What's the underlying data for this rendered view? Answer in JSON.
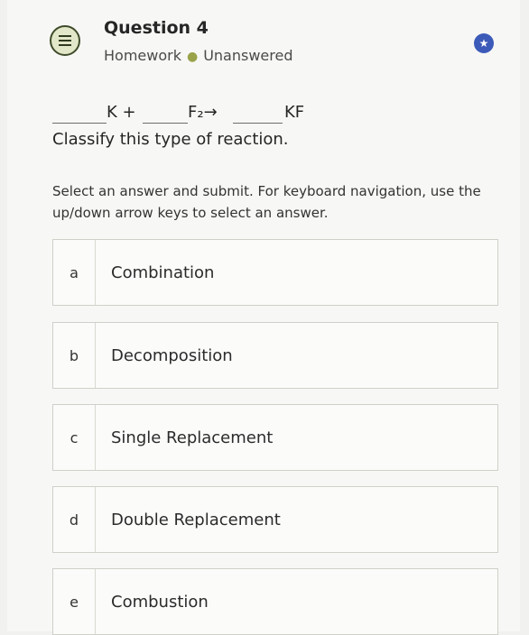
{
  "question": {
    "title": "Question 4",
    "category": "Homework",
    "status": "Unanswered"
  },
  "icons": {
    "question_type": "list-icon",
    "bookmark": "star-icon"
  },
  "equation": {
    "reactant1": "K +",
    "reactant2": "F₂→",
    "product": "KF"
  },
  "prompt": "Classify this type of reaction.",
  "instructions": "Select an answer and submit. For keyboard navigation, use the up/down arrow keys to select an answer.",
  "options": [
    {
      "letter": "a",
      "text": "Combination"
    },
    {
      "letter": "b",
      "text": "Decomposition"
    },
    {
      "letter": "c",
      "text": "Single Replacement"
    },
    {
      "letter": "d",
      "text": "Double Replacement"
    },
    {
      "letter": "e",
      "text": "Combustion"
    }
  ],
  "colors": {
    "accent": "#3c5ab8",
    "icon_bg": "#e3e7c9",
    "status_dot": "#9aa24a"
  }
}
